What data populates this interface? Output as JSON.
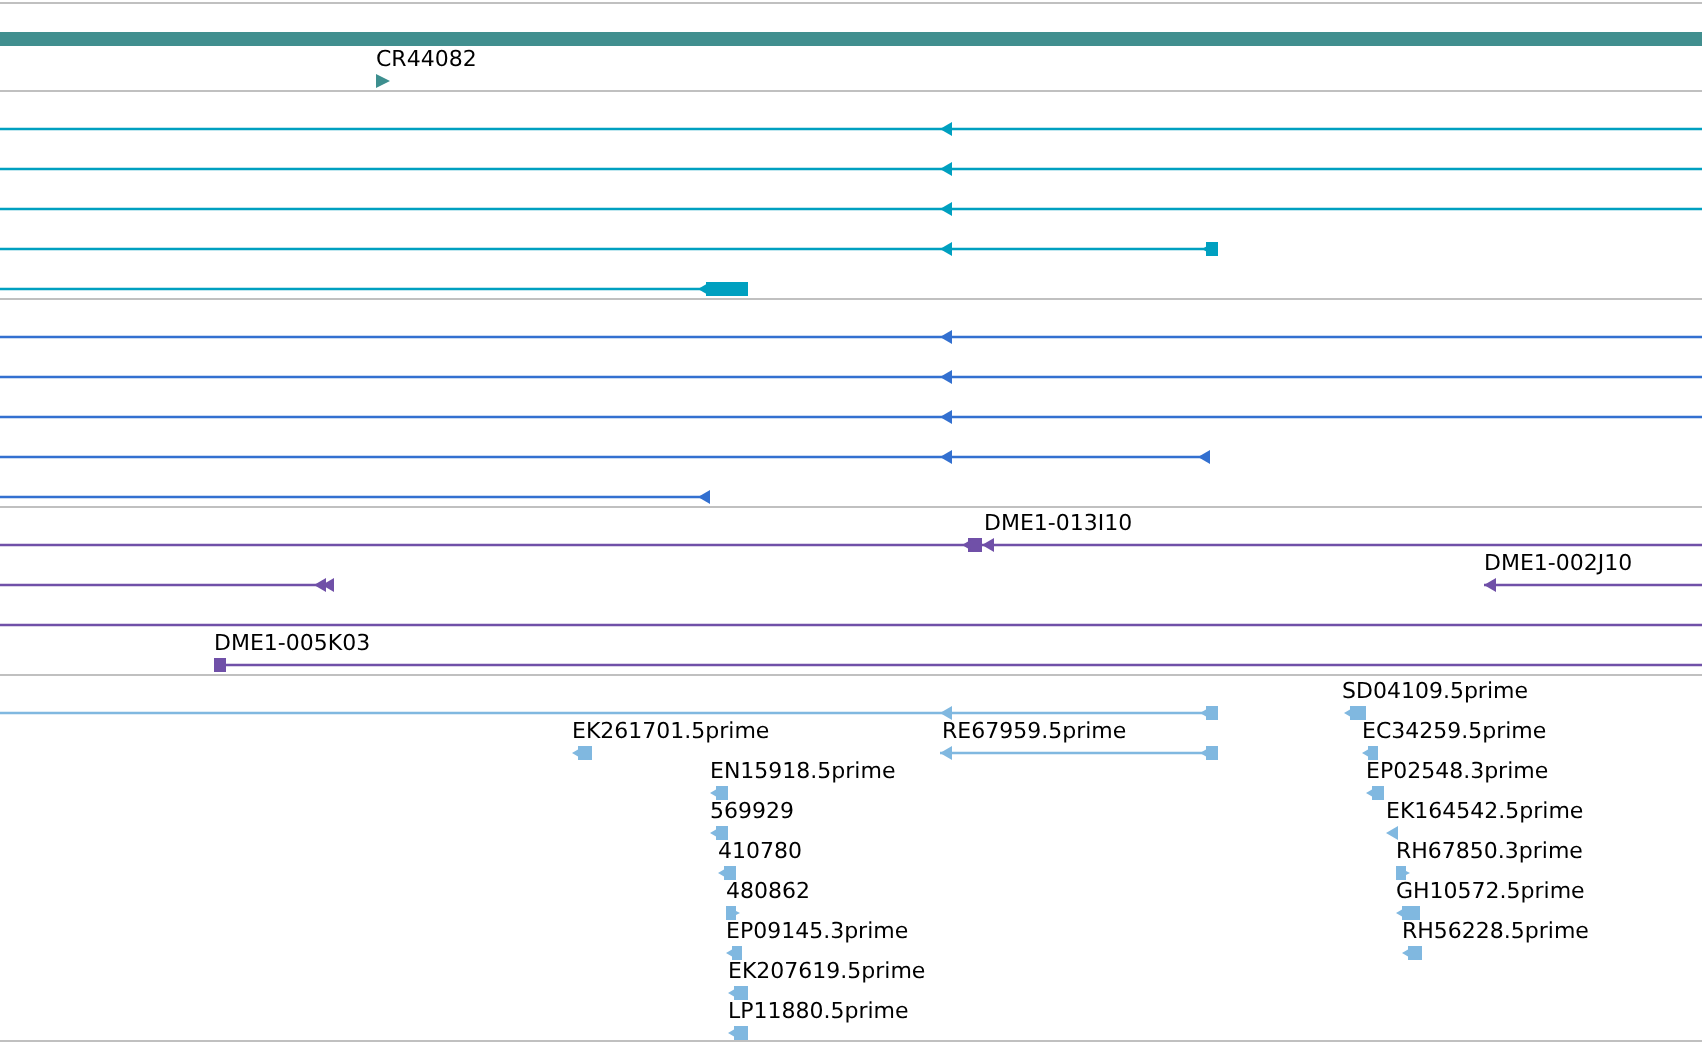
{
  "tracks": [
    {
      "color": "#3d8f8f",
      "features": [
        {
          "label": "CR44082",
          "kind": "arrow",
          "reverse": false
        }
      ]
    },
    {
      "color": "#00a0c0",
      "features": [
        {
          "kind": "arrow",
          "reverse": true
        },
        {
          "kind": "arrow",
          "reverse": true
        },
        {
          "kind": "arrow",
          "reverse": true
        },
        {
          "kind": "arrow",
          "reverse": true
        },
        {
          "kind": "arrow",
          "reverse": true
        }
      ]
    },
    {
      "color": "#3370d0",
      "features": [
        {
          "kind": "arrow",
          "reverse": true
        },
        {
          "kind": "arrow",
          "reverse": true
        },
        {
          "kind": "arrow",
          "reverse": true
        },
        {
          "kind": "arrow",
          "reverse": true
        },
        {
          "kind": "arrow",
          "reverse": true
        }
      ]
    },
    {
      "color": "#7050a8",
      "features": [
        {
          "label": "DME1-013I10",
          "kind": "arrow",
          "reverse": true
        },
        {
          "kind": "arrow",
          "reverse": true
        },
        {
          "label": "DME1-002J10",
          "kind": "arrow",
          "reverse": true
        },
        {
          "kind": "line"
        },
        {
          "label": "DME1-005K03",
          "kind": "arrow",
          "reverse": false
        }
      ]
    },
    {
      "color": "#80b8e0",
      "features": [
        {
          "kind": "arrow",
          "reverse": true
        },
        {
          "label": "SD04109.5prime",
          "kind": "arrow",
          "reverse": true
        },
        {
          "label": "EK261701.5prime",
          "kind": "arrow",
          "reverse": true
        },
        {
          "label": "RE67959.5prime",
          "kind": "arrow",
          "reverse": true
        },
        {
          "label": "EC34259.5prime",
          "kind": "arrow",
          "reverse": true
        },
        {
          "label": "EN15918.5prime",
          "kind": "arrow",
          "reverse": true
        },
        {
          "label": "EP02548.3prime",
          "kind": "arrow",
          "reverse": true
        },
        {
          "label": "569929",
          "kind": "arrow",
          "reverse": true
        },
        {
          "label": "EK164542.5prime",
          "kind": "arrow",
          "reverse": true
        },
        {
          "label": "410780",
          "kind": "arrow",
          "reverse": true
        },
        {
          "label": "RH67850.3prime",
          "kind": "arrow",
          "reverse": false
        },
        {
          "label": "480862",
          "kind": "arrow",
          "reverse": false
        },
        {
          "label": "GH10572.5prime",
          "kind": "arrow",
          "reverse": true
        },
        {
          "label": "EP09145.3prime",
          "kind": "arrow",
          "reverse": true
        },
        {
          "label": "RH56228.5prime",
          "kind": "arrow",
          "reverse": true
        },
        {
          "label": "EK207619.5prime",
          "kind": "arrow",
          "reverse": true
        },
        {
          "label": "LP11880.5prime",
          "kind": "arrow",
          "reverse": true
        }
      ]
    }
  ]
}
